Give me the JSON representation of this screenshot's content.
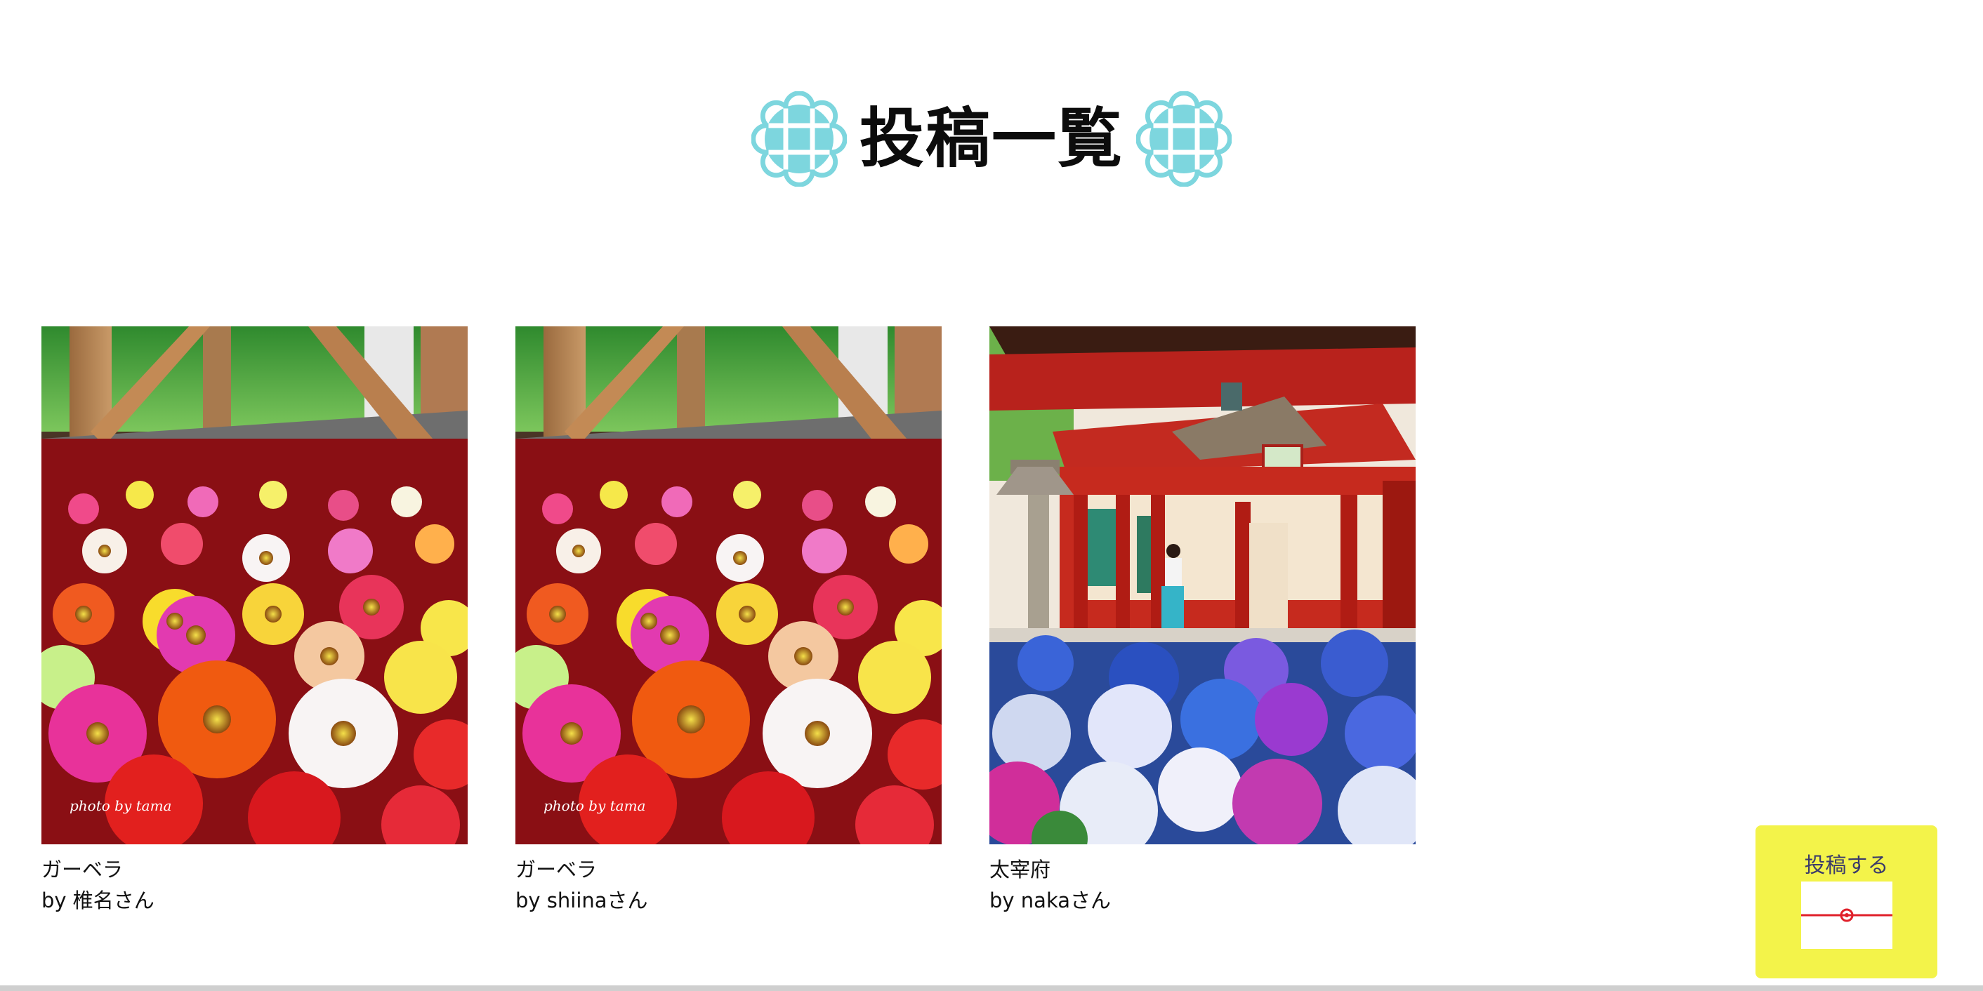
{
  "page": {
    "title": "投稿一覧"
  },
  "posts": [
    {
      "title": "ガーベラ",
      "author": "by 椎名さん",
      "image_icon": "gerbera-flower-photo",
      "watermark": "photo by tama"
    },
    {
      "title": "ガーベラ",
      "author": "by shiinaさん",
      "image_icon": "gerbera-flower-photo",
      "watermark": "photo by tama"
    },
    {
      "title": "太宰府",
      "author": "by nakaさん",
      "image_icon": "dazaifu-shrine-photo"
    }
  ],
  "post_button": {
    "label": "投稿する",
    "icon": "envelope-icon"
  },
  "colors": {
    "accent_knot": "#7dd6de",
    "button_bg": "#f3f34a",
    "button_text": "#3b3b6a",
    "envelope_ribbon": "#e0202a"
  }
}
